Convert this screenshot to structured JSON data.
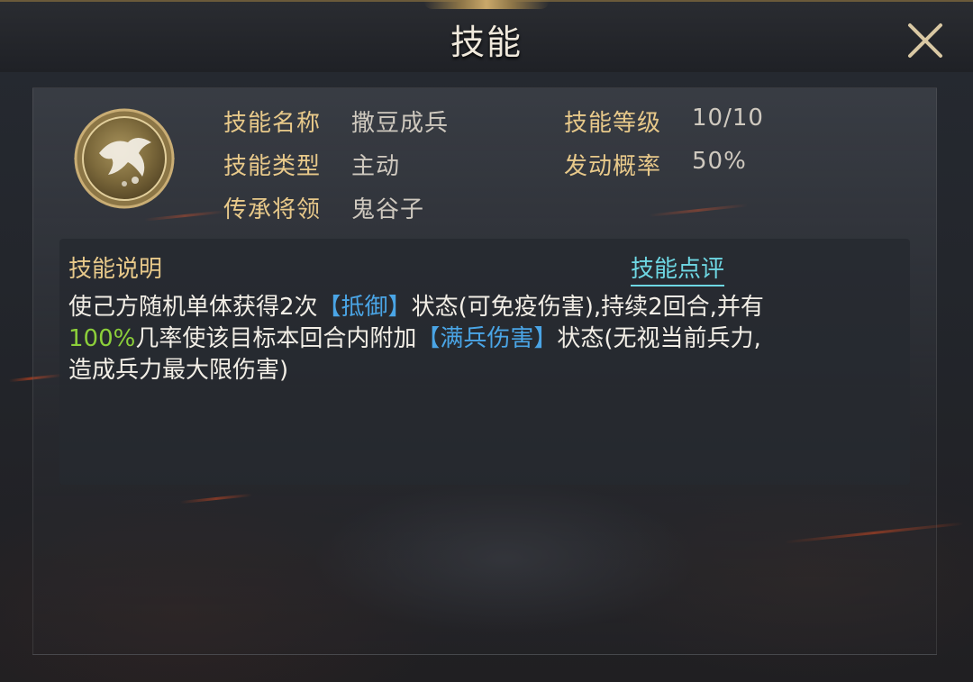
{
  "header": {
    "title": "技能"
  },
  "skill": {
    "name_label": "技能名称",
    "name_value": "撒豆成兵",
    "type_label": "技能类型",
    "type_value": "主动",
    "inherit_label": "传承将领",
    "inherit_value": "鬼谷子",
    "level_label": "技能等级",
    "level_value": "10/10",
    "rate_label": "发动概率",
    "rate_value": "50%"
  },
  "description": {
    "title": "技能说明",
    "review_link": "技能点评",
    "line1_a": "使己方随机单体获得2次",
    "line1_kw": "【抵御】",
    "line1_b": "状态(可免疫伤害),持续2回合,并有",
    "line2_pct": "100%",
    "line2_a": "几率使该目标本回合内附加",
    "line2_kw": "【满兵伤害】",
    "line2_b": "状态(无视当前兵力,",
    "line3": "造成兵力最大限伤害)"
  },
  "colors": {
    "label_gold": "#e8c98a",
    "keyword_blue": "#4aa5e6",
    "percent_green": "#8ccf3a",
    "link_cyan": "#6ed7e3"
  },
  "icons": {
    "close": "close-icon",
    "skill": "skill-soldier-icon"
  }
}
